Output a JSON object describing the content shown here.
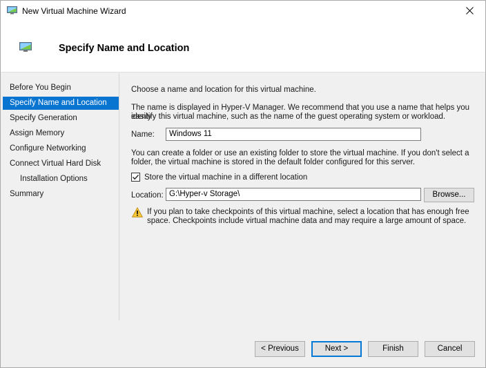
{
  "window": {
    "title": "New Virtual Machine Wizard",
    "icon": "virtual-machine-icon",
    "close_icon": "close-icon"
  },
  "header": {
    "title": "Specify Name and Location",
    "icon": "virtual-machine-icon"
  },
  "nav": {
    "items": [
      {
        "label": "Before You Begin",
        "active": false,
        "indent": false
      },
      {
        "label": "Specify Name and Location",
        "active": true,
        "indent": false
      },
      {
        "label": "Specify Generation",
        "active": false,
        "indent": false
      },
      {
        "label": "Assign Memory",
        "active": false,
        "indent": false
      },
      {
        "label": "Configure Networking",
        "active": false,
        "indent": false
      },
      {
        "label": "Connect Virtual Hard Disk",
        "active": false,
        "indent": false
      },
      {
        "label": "Installation Options",
        "active": false,
        "indent": true
      },
      {
        "label": "Summary",
        "active": false,
        "indent": false
      }
    ],
    "active_color": "#0a74d1"
  },
  "content": {
    "intro": "Choose a name and location for this virtual machine.",
    "name_help_line1": "The name is displayed in Hyper-V Manager. We recommend that you use a name that helps you easily",
    "name_help_line2": "identify this virtual machine, such as the name of the guest operating system or workload.",
    "name_label": "Name:",
    "name_value": "Windows 11",
    "folder_help_line1": "You can create a folder or use an existing folder to store the virtual machine. If you don't select a",
    "folder_help_line2": "folder, the virtual machine is stored in the default folder configured for this server.",
    "store_checkbox_label": "Store the virtual machine in a different location",
    "store_checkbox_checked": true,
    "location_label": "Location:",
    "location_value": "G:\\Hyper-v Storage\\",
    "browse_label": "Browse...",
    "warning_line1": "If you plan to take checkpoints of this virtual machine, select a location that has enough free",
    "warning_line2": "space. Checkpoints include virtual machine data and may require a large amount of space.",
    "warning_icon": "warning-icon"
  },
  "buttons": {
    "previous": "< Previous",
    "next": "Next >",
    "finish": "Finish",
    "cancel": "Cancel"
  }
}
